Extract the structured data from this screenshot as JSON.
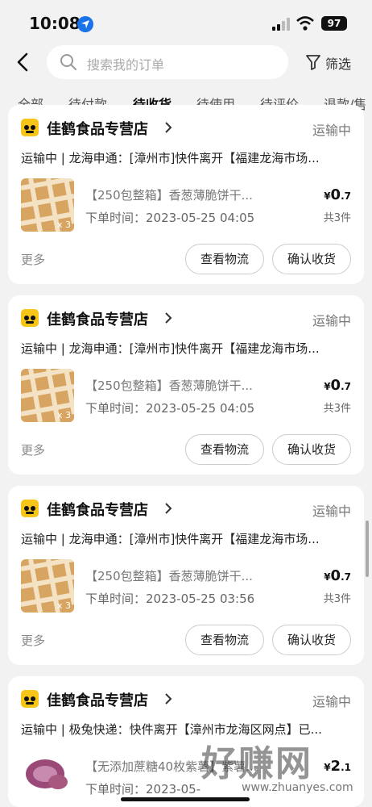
{
  "status_bar": {
    "time": "10:08",
    "battery": "97"
  },
  "search": {
    "placeholder": "搜索我的订单",
    "filter_label": "筛选"
  },
  "tabs": [
    {
      "label": "全部"
    },
    {
      "label": "待付款"
    },
    {
      "label": "待收货",
      "active": true
    },
    {
      "label": "待使用"
    },
    {
      "label": "待评价"
    },
    {
      "label": "退款/售"
    }
  ],
  "orders": [
    {
      "store": "佳鹤食品专营店",
      "status": "运输中",
      "logistics": "运输中 | 龙海申通：[漳州市]快件离开【福建龙海市场...",
      "product_title": "【250包整箱】香葱薄脆饼干...",
      "order_time": "下单时间：2023-05-25 04:05",
      "qty_badge": "x 3",
      "price_symbol": "¥",
      "price_int": "0",
      "price_dec": ".7",
      "count": "共3件",
      "more": "更多",
      "btn_track": "查看物流",
      "btn_confirm": "确认收货"
    },
    {
      "store": "佳鹤食品专营店",
      "status": "运输中",
      "logistics": "运输中 | 龙海申通：[漳州市]快件离开【福建龙海市场...",
      "product_title": "【250包整箱】香葱薄脆饼干...",
      "order_time": "下单时间：2023-05-25 04:05",
      "qty_badge": "x 3",
      "price_symbol": "¥",
      "price_int": "0",
      "price_dec": ".7",
      "count": "共3件",
      "more": "更多",
      "btn_track": "查看物流",
      "btn_confirm": "确认收货"
    },
    {
      "store": "佳鹤食品专营店",
      "status": "运输中",
      "logistics": "运输中 | 龙海申通：[漳州市]快件离开【福建龙海市场...",
      "product_title": "【250包整箱】香葱薄脆饼干...",
      "order_time": "下单时间：2023-05-25 03:56",
      "qty_badge": "x 3",
      "price_symbol": "¥",
      "price_int": "0",
      "price_dec": ".7",
      "count": "共3件",
      "more": "更多",
      "btn_track": "查看物流",
      "btn_confirm": "确认收货"
    },
    {
      "store": "佳鹤食品专营店",
      "status": "运输中",
      "logistics": "运输中 | 极兔快递：快件离开【漳州市龙海区网点】已...",
      "product_title": "【无添加蔗糖40枚紫薯】紫薯...",
      "order_time": "下单时间：2023-05-",
      "qty_badge": "x 7",
      "price_symbol": "¥",
      "price_int": "2",
      "price_dec": ".1"
    }
  ],
  "watermark": {
    "text": "好赚网",
    "url": "www.zhuanyes.com"
  }
}
